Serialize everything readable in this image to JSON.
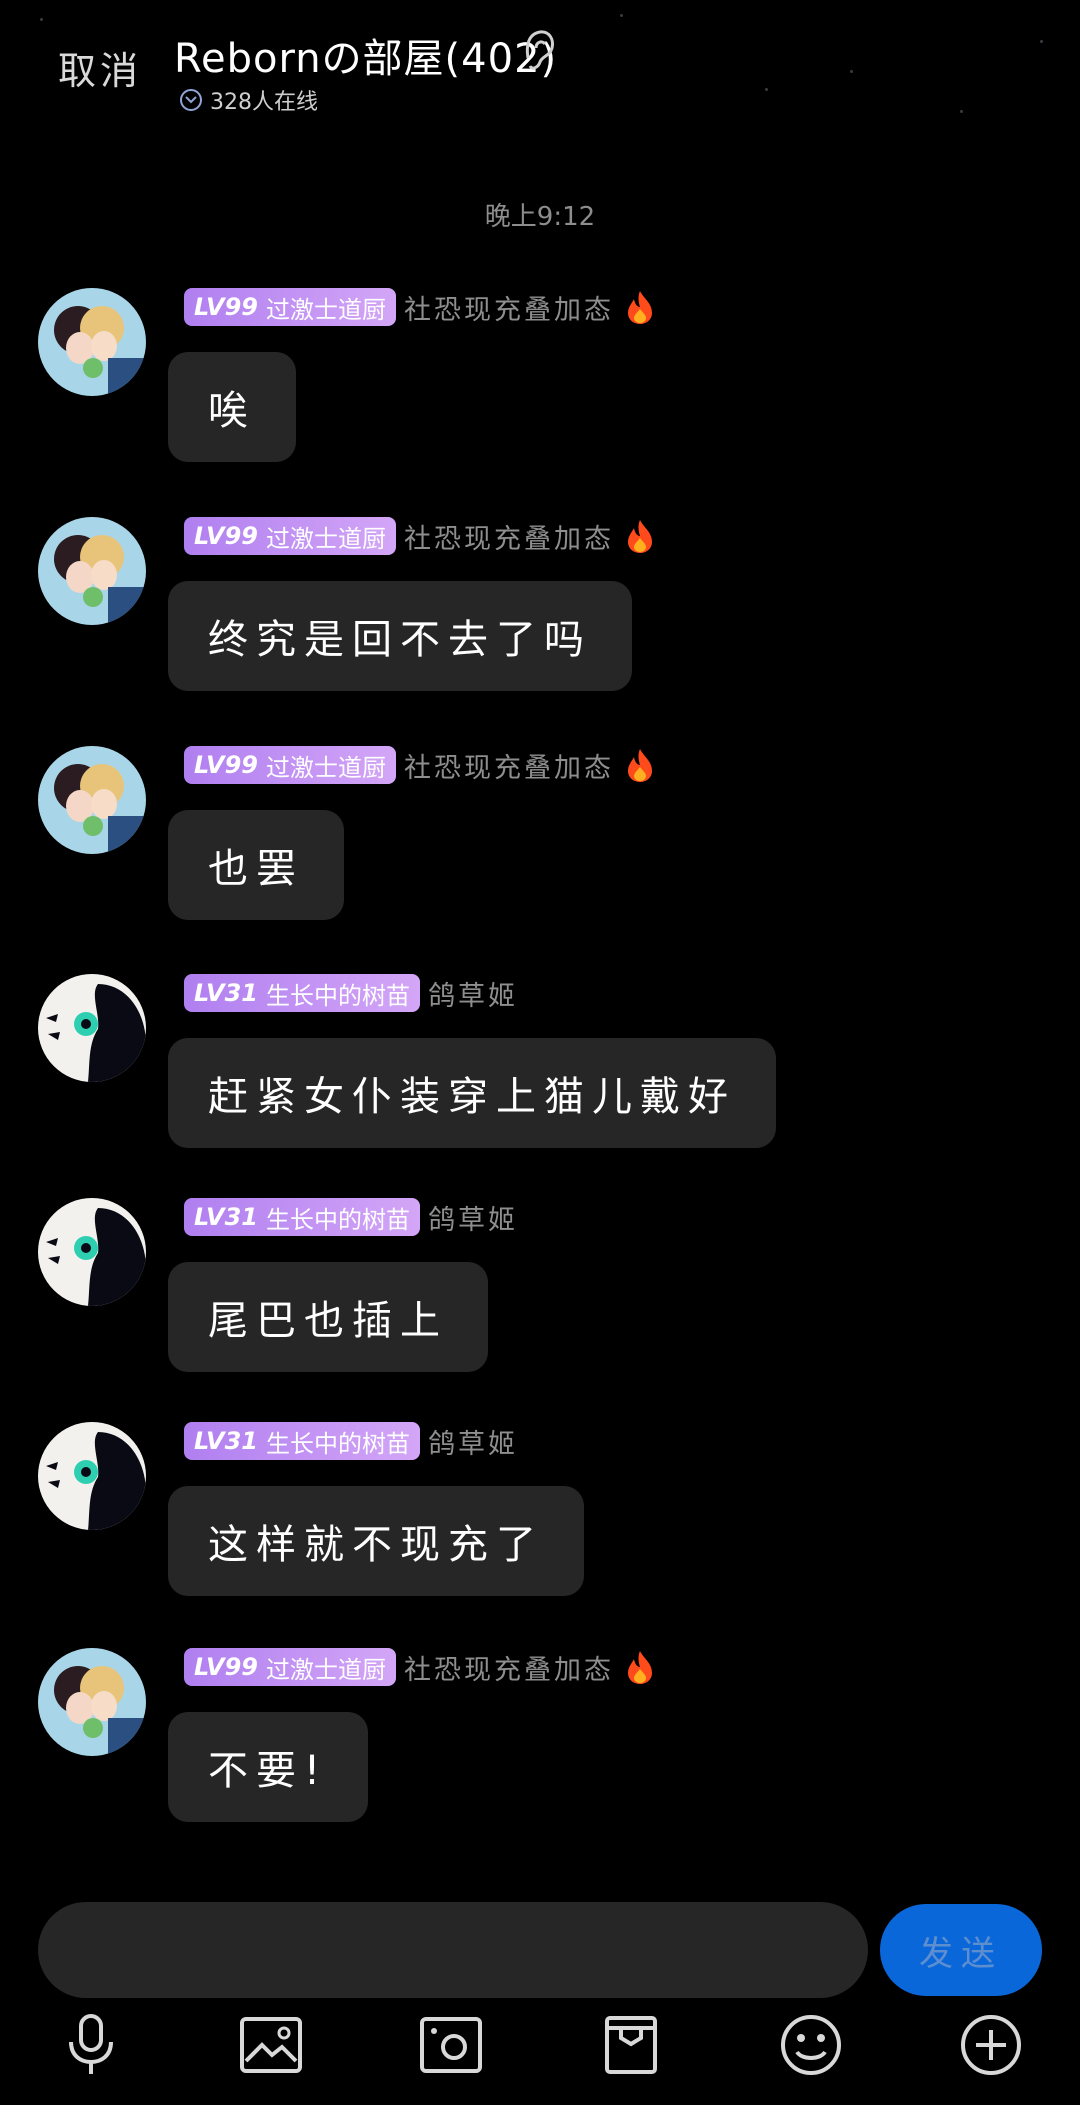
{
  "header": {
    "cancel_label": "取消",
    "room_title": "Rebornの部屋(402)",
    "online_count": "328人在线"
  },
  "timestamp": "晚上9:12",
  "messages": [
    {
      "level": "LV99",
      "badge_title": "过激士道厨",
      "nickname": "社恐现充叠加态",
      "has_fire": true,
      "text": "唉",
      "avatar": "avatar-anime-pair"
    },
    {
      "level": "LV99",
      "badge_title": "过激士道厨",
      "nickname": "社恐现充叠加态",
      "has_fire": true,
      "text": "终究是回不去了吗",
      "avatar": "avatar-anime-pair"
    },
    {
      "level": "LV99",
      "badge_title": "过激士道厨",
      "nickname": "社恐现充叠加态",
      "has_fire": true,
      "text": "也罢",
      "avatar": "avatar-anime-pair"
    },
    {
      "level": "LV31",
      "badge_title": "生长中的树苗",
      "nickname": "鸽草姬",
      "has_fire": false,
      "text": "赶紧女仆装穿上猫儿戴好",
      "avatar": "avatar-silhouette"
    },
    {
      "level": "LV31",
      "badge_title": "生长中的树苗",
      "nickname": "鸽草姬",
      "has_fire": false,
      "text": "尾巴也插上",
      "avatar": "avatar-silhouette"
    },
    {
      "level": "LV31",
      "badge_title": "生长中的树苗",
      "nickname": "鸽草姬",
      "has_fire": false,
      "text": "这样就不现充了",
      "avatar": "avatar-silhouette"
    },
    {
      "level": "LV99",
      "badge_title": "过激士道厨",
      "nickname": "社恐现充叠加态",
      "has_fire": true,
      "text": "不要!",
      "avatar": "avatar-anime-pair"
    }
  ],
  "input": {
    "value": "",
    "send_label": "发送"
  },
  "toolbar": {
    "icons": [
      "microphone-icon",
      "image-icon",
      "camera-icon",
      "bag-icon",
      "emoji-icon",
      "plus-icon"
    ]
  },
  "colors": {
    "badge_gradient_start": "#b07ff0",
    "send_button": "#0a67d9",
    "bubble": "#262626"
  }
}
